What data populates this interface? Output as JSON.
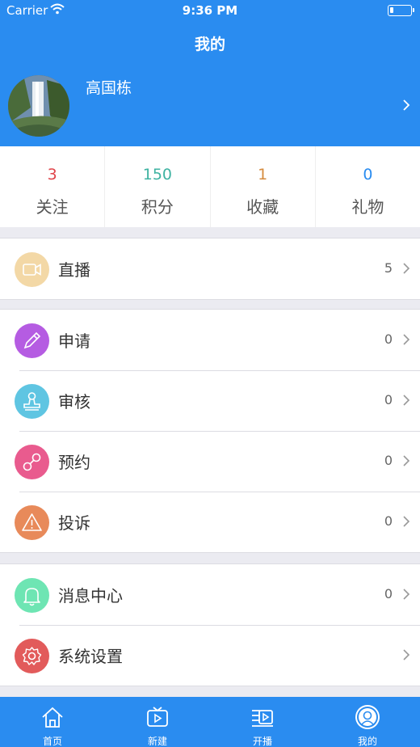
{
  "status_bar": {
    "carrier": "Carrier",
    "time": "9:36 PM"
  },
  "header": {
    "title": "我的",
    "username": "高国栋"
  },
  "stats": [
    {
      "value": "3",
      "label": "关注",
      "color": "#e0454b"
    },
    {
      "value": "150",
      "label": "积分",
      "color": "#3fb3a2"
    },
    {
      "value": "1",
      "label": "收藏",
      "color": "#d58b3e"
    },
    {
      "value": "0",
      "label": "礼物",
      "color": "#2a8cf0"
    }
  ],
  "menu": {
    "live": {
      "label": "直播",
      "count": "5",
      "color": "#f3d8a6",
      "icon": "video-camera-icon"
    },
    "apply": {
      "label": "申请",
      "count": "0",
      "color": "#b55ce2",
      "icon": "pen-icon"
    },
    "review": {
      "label": "审核",
      "count": "0",
      "color": "#5fc5e2",
      "icon": "stamp-icon"
    },
    "reservation": {
      "label": "预约",
      "count": "0",
      "color": "#e95b8e",
      "icon": "link-icon"
    },
    "complaint": {
      "label": "投诉",
      "count": "0",
      "color": "#e88a5a",
      "icon": "warning-icon"
    },
    "messages": {
      "label": "消息中心",
      "count": "0",
      "color": "#6ee5b3",
      "icon": "bell-icon"
    },
    "settings": {
      "label": "系统设置",
      "color": "#e25b5b",
      "icon": "gear-icon"
    }
  },
  "tabbar": [
    {
      "label": "首页",
      "icon": "home-icon"
    },
    {
      "label": "新建",
      "icon": "tv-play-icon"
    },
    {
      "label": "开播",
      "icon": "broadcast-icon"
    },
    {
      "label": "我的",
      "icon": "profile-icon"
    }
  ]
}
